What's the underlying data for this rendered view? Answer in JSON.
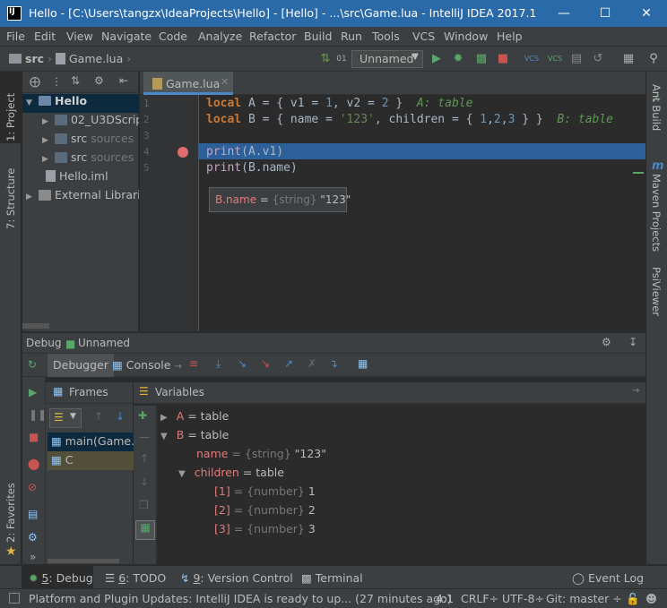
{
  "window": {
    "title": "Hello - [C:\\Users\\tangzx\\IdeaProjects\\Hello] - [Hello] - ...\\src\\Game.lua - IntelliJ IDEA 2017.1",
    "app_icon": "IJ"
  },
  "menu": [
    "File",
    "Edit",
    "View",
    "Navigate",
    "Code",
    "Analyze",
    "Refactor",
    "Build",
    "Run",
    "Tools",
    "VCS",
    "Window",
    "Help"
  ],
  "breadcrumb": {
    "folder": "src",
    "file": "Game.lua"
  },
  "toolbar": {
    "run_config": "Unnamed"
  },
  "left_tabs": {
    "project": "1: Project",
    "structure": "7: Structure",
    "favorites": "2: Favorites"
  },
  "right_tabs": {
    "ant": "Ant Build",
    "maven": "Maven Projects",
    "psi": "PsiViewer"
  },
  "project_tree": [
    {
      "label": "Hello",
      "bold": true
    },
    {
      "label": "02_U3DScrip"
    },
    {
      "label": "src",
      "suffix": "sources"
    },
    {
      "label": "src",
      "suffix": "sources"
    },
    {
      "label": "Hello.iml"
    },
    {
      "label": "External Librarie"
    }
  ],
  "editor": {
    "tab": "Game.lua",
    "line_numbers": [
      "1",
      "2",
      "3",
      "4",
      "5"
    ],
    "lines": [
      {
        "kw": "local",
        "rest1": " A = { v1 = ",
        "n1": "1",
        "rest2": ", v2 = ",
        "n2": "2",
        "rest3": " }",
        "hint": "A: table"
      },
      {
        "kw": "local",
        "rest1": " B = { name = ",
        "s1": "'123'",
        "rest2": ", children = { ",
        "n1": "1",
        "c1": ",",
        "n2": "2",
        "c2": ",",
        "n3": "3",
        "rest3": " } }",
        "hint": "B: table"
      },
      {
        "text": ""
      },
      {
        "fn": "print",
        "arg": "(A.v1)"
      },
      {
        "fn": "print",
        "arg": "(B.name)"
      }
    ],
    "tooltip": {
      "name": "B.name",
      "eq": " = ",
      "type": "{string}",
      "value": " \"123\""
    }
  },
  "debug": {
    "title": "Debug",
    "config": "Unnamed",
    "tabs": {
      "debugger": "Debugger",
      "console": "Console"
    },
    "frames_label": "Frames",
    "variables_label": "Variables",
    "frames": [
      "main(Game.l",
      "C"
    ],
    "variables": [
      {
        "indent": 0,
        "arrow": "▶",
        "name": "A",
        "text": " = table"
      },
      {
        "indent": 0,
        "arrow": "▼",
        "name": "B",
        "text": " = table"
      },
      {
        "indent": 1,
        "arrow": "",
        "name": "name",
        "type": " = {string} ",
        "text": "\"123\""
      },
      {
        "indent": 1,
        "arrow": "▼",
        "name": "children",
        "text": " = table"
      },
      {
        "indent": 2,
        "arrow": "",
        "name": "[1]",
        "type": " = {number} ",
        "text": "1"
      },
      {
        "indent": 2,
        "arrow": "",
        "name": "[2]",
        "type": " = {number} ",
        "text": "2"
      },
      {
        "indent": 2,
        "arrow": "",
        "name": "[3]",
        "type": " = {number} ",
        "text": "3"
      }
    ]
  },
  "bottom_tabs": [
    {
      "num": "5",
      "label": ": Debug"
    },
    {
      "num": "6",
      "label": ": TODO"
    },
    {
      "num": "9",
      "label": ": Version Control"
    },
    {
      "num": "",
      "label": "Terminal"
    }
  ],
  "event_log": "Event Log",
  "status": {
    "message": "Platform and Plugin Updates: IntelliJ IDEA is ready to up... (27 minutes ago)",
    "position": "4:1",
    "line_sep": "CRLF÷",
    "encoding": "UTF-8÷",
    "git": "Git: master ÷"
  },
  "colors": {
    "accent": "#2b6aa8",
    "selection": "#2d6099",
    "keyword": "#cc7832",
    "number": "#6897bb",
    "string": "#6a8759"
  }
}
